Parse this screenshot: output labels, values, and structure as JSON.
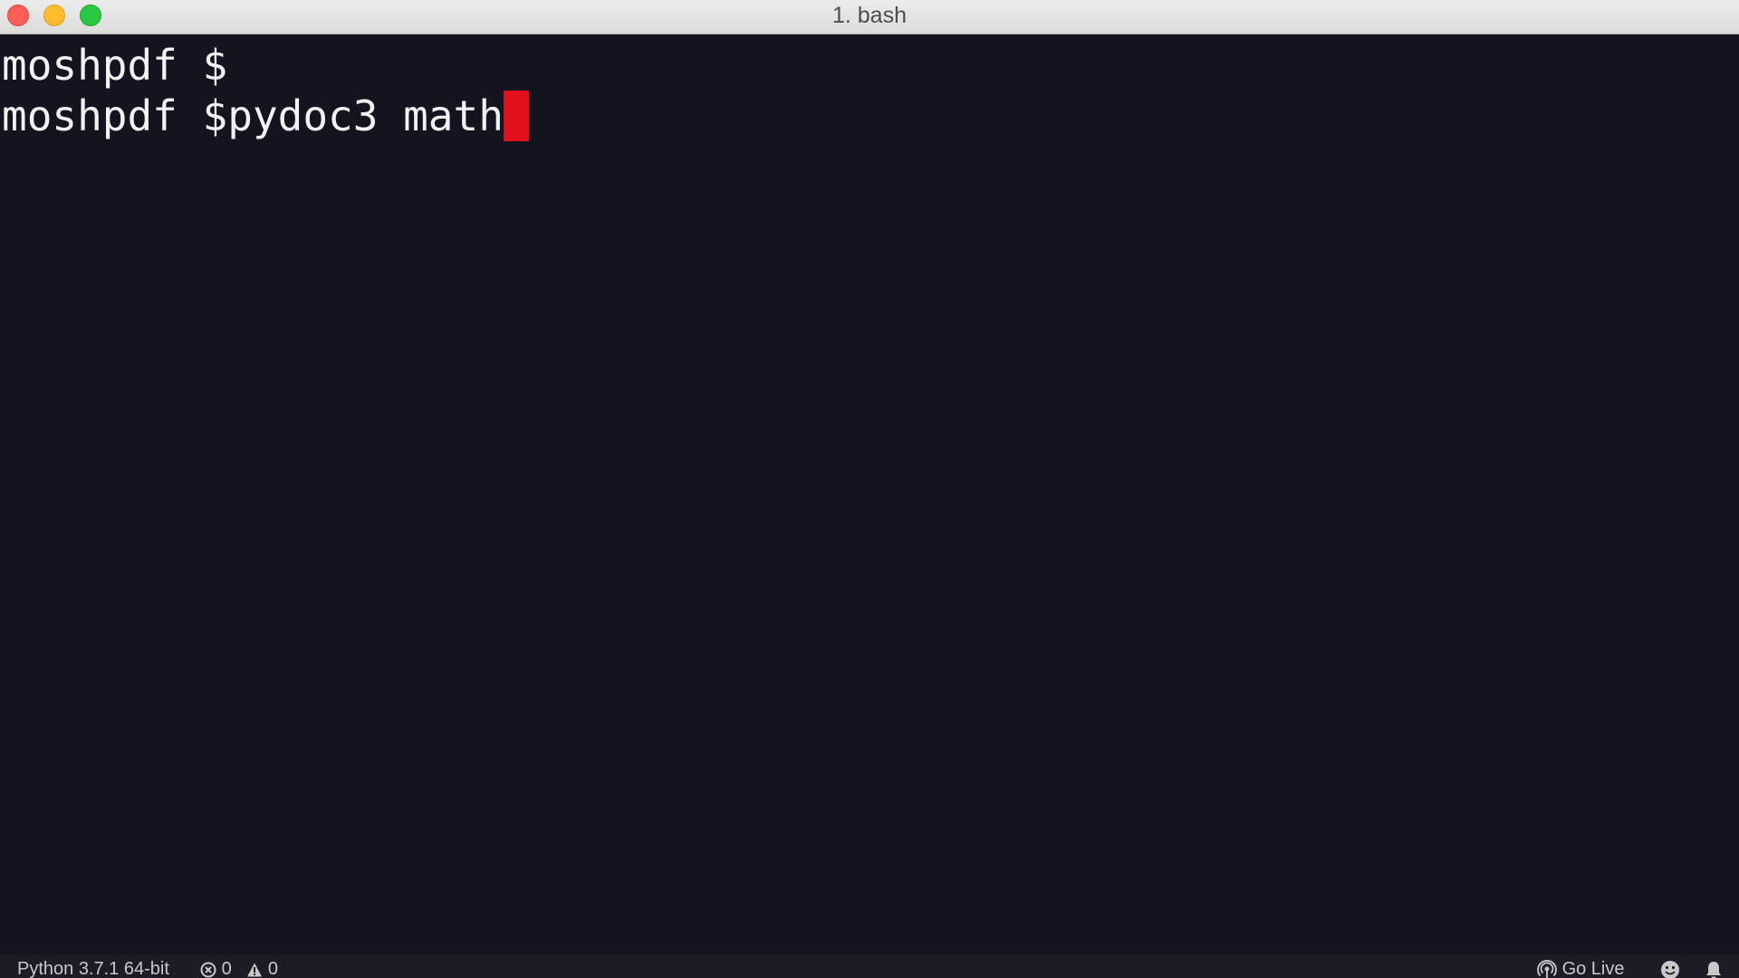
{
  "window": {
    "title": "1. bash"
  },
  "terminal": {
    "lines": [
      "moshpdf $",
      "moshpdf $pydoc3 math"
    ],
    "cursor_color": "#e2101d",
    "background": "#13141f",
    "foreground": "#f2f2f2"
  },
  "statusbar": {
    "interpreter": "Python 3.7.1 64-bit",
    "errors": "0",
    "warnings": "0",
    "go_live": "Go Live",
    "icons": [
      "error-icon",
      "warning-icon",
      "broadcast-icon",
      "smiley-icon",
      "bell-icon"
    ]
  }
}
